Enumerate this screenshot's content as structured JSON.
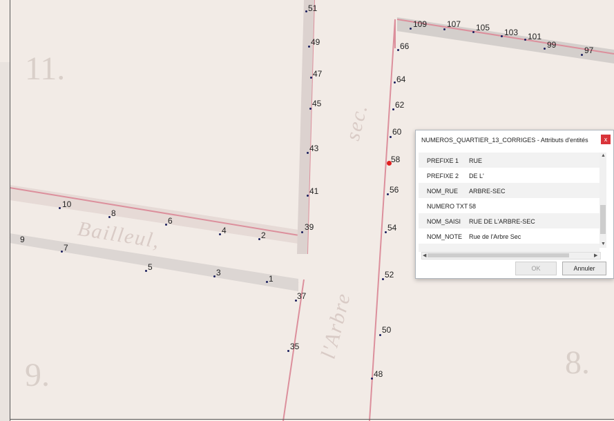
{
  "map": {
    "block_numbers": {
      "b11": "11.",
      "b9": "9.",
      "b8": "8."
    },
    "street_labels": {
      "bailleul": "Bailleul,",
      "arbre": "l'Arbre",
      "sec": "sec."
    },
    "address_numbers": {
      "n51": "51",
      "n49": "49",
      "n47": "47",
      "n45": "45",
      "n43": "43",
      "n41": "41",
      "n39": "39",
      "n37": "37",
      "n35": "35",
      "n109": "109",
      "n107": "107",
      "n105": "105",
      "n103": "103",
      "n101": "101",
      "n99": "99",
      "n97": "97",
      "n66": "66",
      "n64": "64",
      "n62": "62",
      "n60": "60",
      "n58": "58",
      "n56": "56",
      "n54": "54",
      "n52": "52",
      "n50": "50",
      "n48": "48",
      "n10": "10",
      "n8": "8",
      "n6": "6",
      "n4": "4",
      "n2": "2",
      "n9": "9",
      "n7": "7",
      "n5": "5",
      "n3": "3",
      "n1": "1"
    },
    "selected_feature": "58"
  },
  "dialog": {
    "title": "NUMEROS_QUARTIER_13_CORRIGES - Attributs d'entités",
    "close_label": "x",
    "attributes": [
      {
        "key": "PREFIXE 1",
        "value": "RUE"
      },
      {
        "key": "PREFIXE 2",
        "value": "DE L'"
      },
      {
        "key": "NOM_RUE",
        "value": "ARBRE-SEC"
      },
      {
        "key": "NUMERO TXT",
        "value": "58"
      },
      {
        "key": "NOM_SAISI",
        "value": "RUE DE L'ARBRE-SEC"
      },
      {
        "key": "NOM_NOTE",
        "value": "Rue de l'Arbre Sec"
      }
    ],
    "ok_label": "OK",
    "cancel_label": "Annuler",
    "scroll_up": "▲",
    "scroll_down": "▼",
    "scroll_left": "◀",
    "scroll_right": "▶"
  },
  "colors": {
    "paper": "#f2ebe6",
    "street_edge": "#dc8f9c",
    "street_shadow": "#b8b8b8",
    "point": "#1b1f5e",
    "selected_point": "#e02020",
    "close_button": "#d9343a"
  }
}
